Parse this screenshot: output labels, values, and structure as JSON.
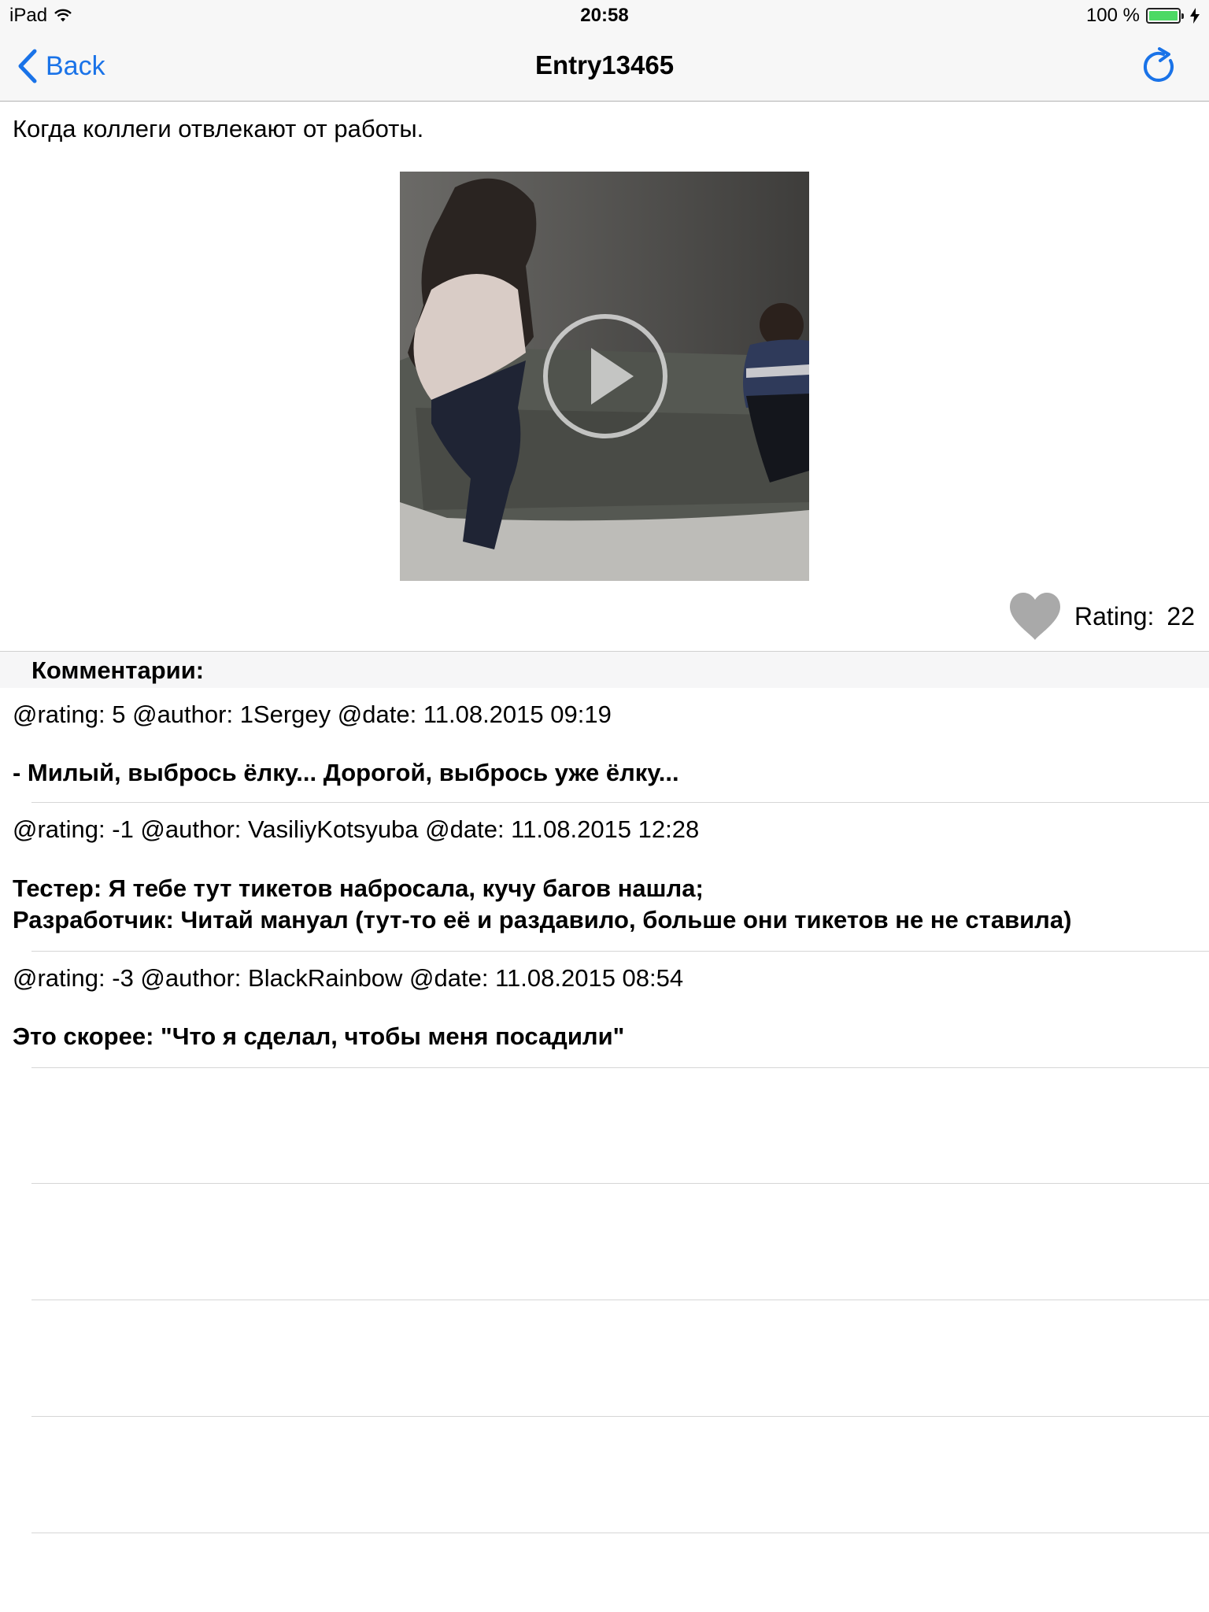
{
  "status_bar": {
    "device": "iPad",
    "time": "20:58",
    "battery": "100 %",
    "wifi_icon": "wifi-icon",
    "battery_icon": "battery-icon",
    "charging_icon": "bolt-icon"
  },
  "nav": {
    "back_label": "Back",
    "title": "Entry13465",
    "refresh_icon": "refresh-icon",
    "accent_color": "#1a73e8"
  },
  "entry": {
    "text": "Когда коллеги отвлекают от работы.",
    "play_icon": "play-icon",
    "rating_label": "Rating:",
    "rating_value": "22",
    "heart_icon": "heart-icon",
    "heart_color": "#a9a9a9"
  },
  "comments": {
    "header": "Комментарии:",
    "items": [
      {
        "meta": "@rating: 5 @author: 1Sergey @date: 11.08.2015 09:19",
        "body": "- Милый, выбрось ёлку... Дорогой, выбрось уже ёлку..."
      },
      {
        "meta": "@rating: -1 @author: VasiliyKotsyuba @date: 11.08.2015 12:28",
        "body": "Тестер: Я тебе тут тикетов набросала, кучу багов нашла;\nРазработчик: Читай мануал (тут-то её и раздавило, больше они тикетов не не ставила)"
      },
      {
        "meta": "@rating: -3 @author: BlackRainbow @date: 11.08.2015 08:54",
        "body": "Это скорее: \"Что я сделал, чтобы меня посадили\""
      }
    ]
  }
}
